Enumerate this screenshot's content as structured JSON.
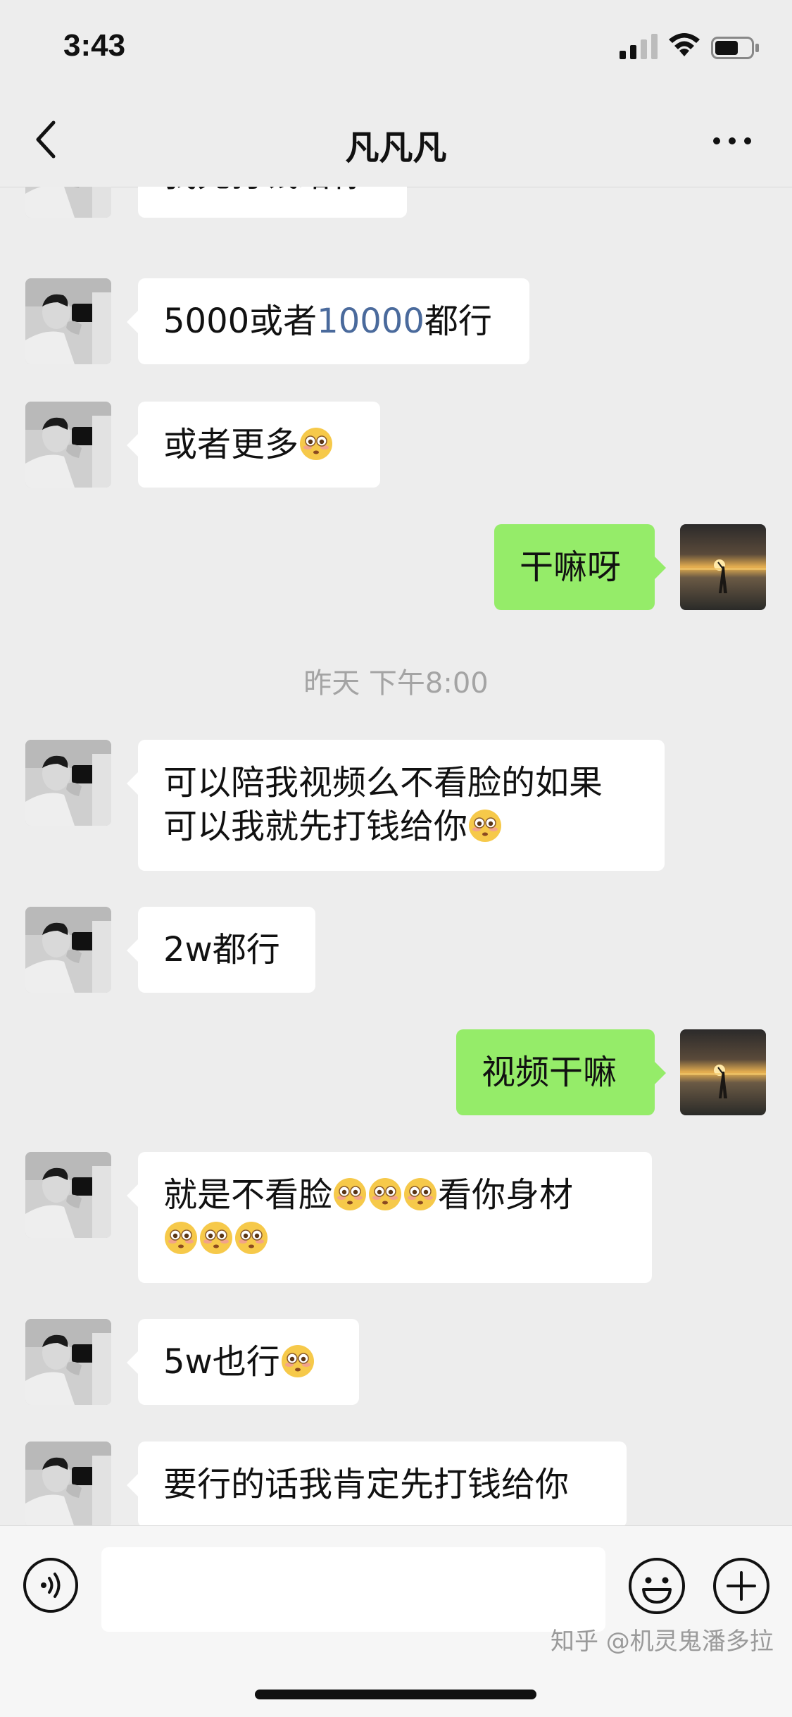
{
  "status_bar": {
    "time": "3:43"
  },
  "nav": {
    "title": "凡凡凡"
  },
  "messages": {
    "m0": "我先打钱给你",
    "m1_a": "5000或者",
    "m1_b": "10000",
    "m1_c": "都行",
    "m2": "或者更多",
    "m3": "干嘛呀",
    "ts": "昨天 下午8:00",
    "m4_l1": "可以陪我视频么不看脸的如果",
    "m4_l2": "可以我就先打钱给你",
    "m5": "2w都行",
    "m6": "视频干嘛",
    "m7_a": "就是不看脸",
    "m7_b": "看你身材",
    "m8": "5w也行",
    "m9": "要行的话我肯定先打钱给你"
  },
  "icons": {
    "back": "chevron-left-icon",
    "more": "more-dots-icon",
    "voice": "voice-icon",
    "emoji": "emoji-icon",
    "plus": "plus-icon",
    "emoji_in_text": "flushed-face-emoji"
  },
  "colors": {
    "sent_bubble": "#95ec69",
    "received_bubble": "#ffffff",
    "background": "#ededed",
    "highlight_number": "#4a6a9c"
  },
  "watermark": "知乎 @机灵鬼潘多拉"
}
